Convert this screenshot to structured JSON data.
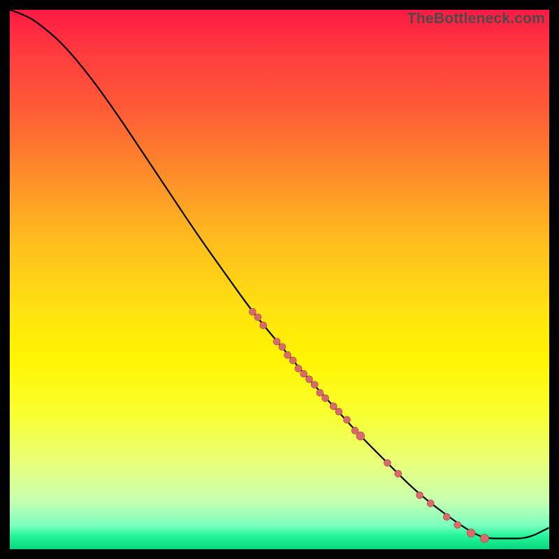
{
  "watermark": "TheBottleneck.com",
  "colors": {
    "frame": "#000000",
    "line": "#000000",
    "dot_fill": "#d86a6a",
    "dot_stroke": "#a84646"
  },
  "chart_data": {
    "type": "line",
    "title": "",
    "xlabel": "",
    "ylabel": "",
    "xlim": [
      0,
      100
    ],
    "ylim": [
      0,
      100
    ],
    "series": [
      {
        "name": "bottleneck-curve",
        "x": [
          0,
          3,
          6,
          10,
          15,
          20,
          25,
          30,
          35,
          40,
          45,
          50,
          55,
          60,
          65,
          70,
          75,
          80,
          85,
          88,
          92,
          96,
          100
        ],
        "y": [
          100,
          99,
          97,
          93.5,
          87.5,
          80.5,
          73,
          65.5,
          58,
          51,
          44,
          38,
          32,
          26.5,
          21,
          16,
          11,
          7,
          3.5,
          2,
          2,
          2,
          4
        ]
      }
    ],
    "markers": [
      {
        "x": 45.0,
        "y": 44.0,
        "r": 5
      },
      {
        "x": 46.0,
        "y": 43.0,
        "r": 5
      },
      {
        "x": 47.0,
        "y": 41.5,
        "r": 5
      },
      {
        "x": 49.5,
        "y": 38.5,
        "r": 5
      },
      {
        "x": 50.5,
        "y": 37.5,
        "r": 5
      },
      {
        "x": 51.5,
        "y": 36.0,
        "r": 5
      },
      {
        "x": 52.5,
        "y": 35.0,
        "r": 5
      },
      {
        "x": 53.5,
        "y": 33.5,
        "r": 5
      },
      {
        "x": 54.5,
        "y": 32.5,
        "r": 5
      },
      {
        "x": 55.5,
        "y": 31.5,
        "r": 5
      },
      {
        "x": 56.5,
        "y": 30.5,
        "r": 5
      },
      {
        "x": 57.5,
        "y": 29.0,
        "r": 5
      },
      {
        "x": 58.5,
        "y": 28.0,
        "r": 5
      },
      {
        "x": 60.0,
        "y": 26.5,
        "r": 5
      },
      {
        "x": 61.0,
        "y": 25.5,
        "r": 5
      },
      {
        "x": 62.5,
        "y": 24.0,
        "r": 5
      },
      {
        "x": 64.0,
        "y": 22.0,
        "r": 5
      },
      {
        "x": 65.0,
        "y": 21.0,
        "r": 6
      },
      {
        "x": 70.0,
        "y": 16.0,
        "r": 5
      },
      {
        "x": 72.0,
        "y": 14.0,
        "r": 5
      },
      {
        "x": 76.0,
        "y": 10.0,
        "r": 5
      },
      {
        "x": 78.0,
        "y": 8.5,
        "r": 5
      },
      {
        "x": 81.0,
        "y": 6.0,
        "r": 5
      },
      {
        "x": 83.0,
        "y": 4.5,
        "r": 5
      },
      {
        "x": 85.5,
        "y": 3.0,
        "r": 6
      },
      {
        "x": 88.0,
        "y": 2.0,
        "r": 6
      }
    ]
  }
}
